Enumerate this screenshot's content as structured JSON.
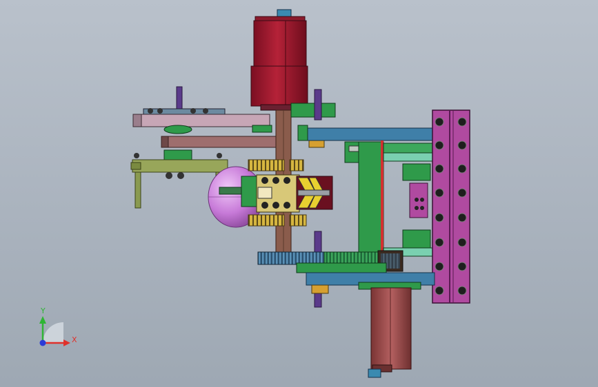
{
  "window": {
    "background_top": "#b9c1cb",
    "background_bottom": "#9ea8b3"
  },
  "triad": {
    "x_label": "X",
    "y_label": "Y",
    "x_color": "#e0312b",
    "y_color": "#2fb534",
    "z_color": "#2b3bd8"
  },
  "colors": {
    "motor_red": "#a01830",
    "motor_lower": "#9a4a48",
    "plate_blue": "#3f7fa8",
    "plate_purple": "#b04aa0",
    "green_part": "#2f9a4a",
    "olive_arm": "#98a65a",
    "gear_blue": "#3a6a90",
    "yellow_part": "#d6b640",
    "brown_frame": "#7a4a3a",
    "sphere": "#c77ad8"
  },
  "icons": [
    "axis-triad-icon"
  ]
}
